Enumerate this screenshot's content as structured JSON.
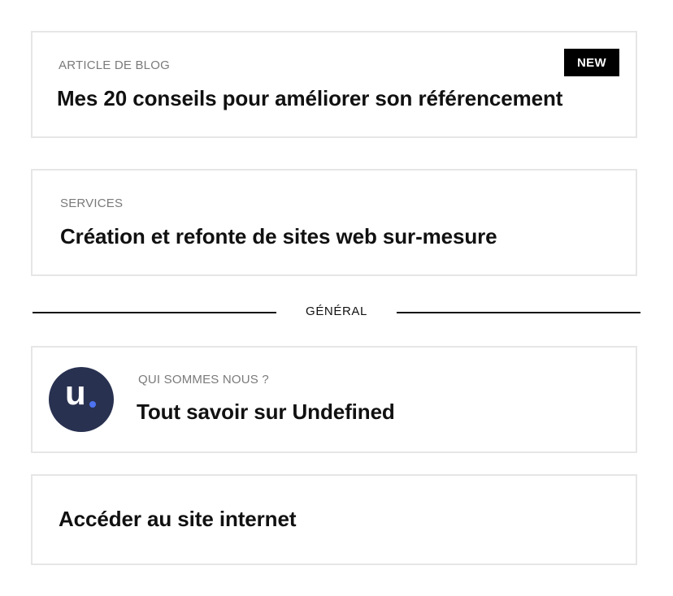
{
  "cards": [
    {
      "eyebrow": "ARTICLE DE BLOG",
      "title": "Mes 20 conseils pour améliorer son référencement",
      "badge": "NEW"
    },
    {
      "eyebrow": "SERVICES",
      "title": "Création et refonte de sites web sur-mesure"
    },
    {
      "eyebrow": "QUI SOMMES NOUS ?",
      "title": "Tout savoir sur Undefined",
      "avatar_letter": "u",
      "avatar_colors": {
        "background": "#283150",
        "dot": "#4d73f0"
      }
    },
    {
      "title": "Accéder au site internet"
    }
  ],
  "divider": {
    "label": "GÉNÉRAL"
  },
  "colors": {
    "card_border": "#e6e6e6",
    "eyebrow_text": "#7a7a7a",
    "title_text": "#111111",
    "badge_bg": "#000000",
    "badge_text": "#ffffff"
  }
}
